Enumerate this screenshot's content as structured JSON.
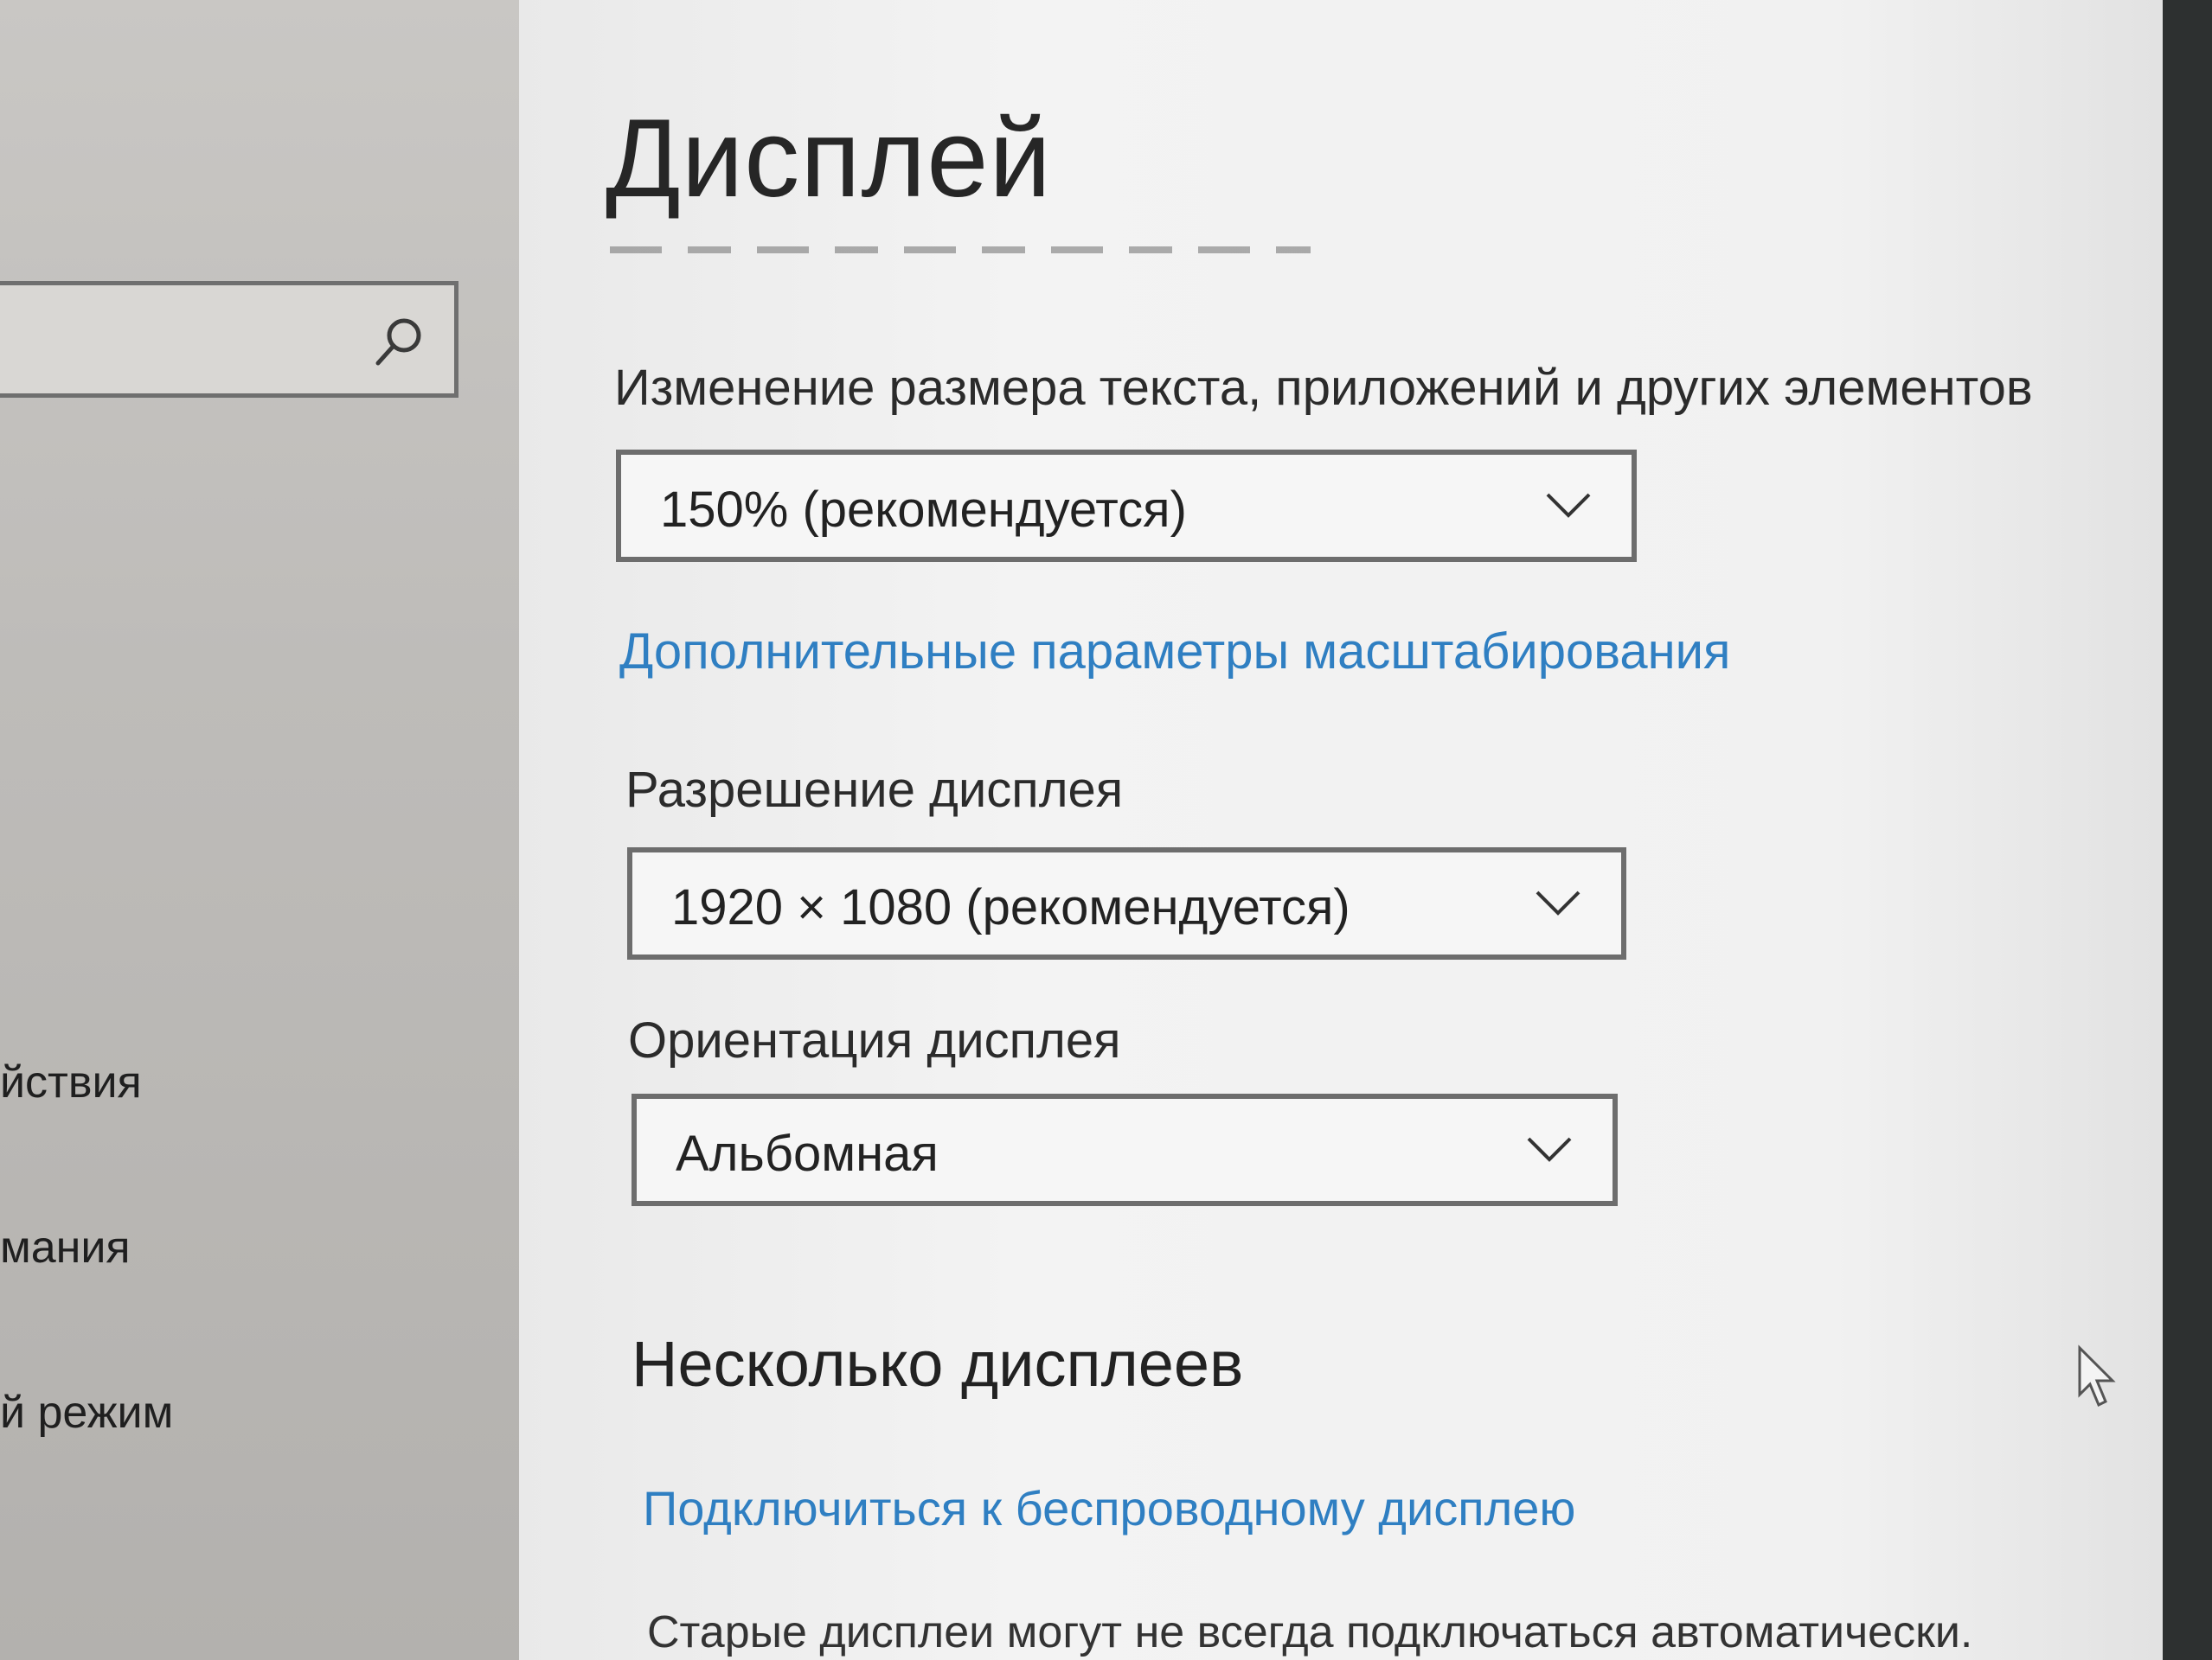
{
  "sidebar": {
    "search": {
      "value": "",
      "icon": "search-icon"
    },
    "items": [
      {
        "label": "йствия"
      },
      {
        "label": "мания"
      },
      {
        "label": "й режим"
      }
    ]
  },
  "main": {
    "title": "Дисплей",
    "scale": {
      "label": "Изменение размера текста, приложений и других элементов",
      "selected": "150% (рекомендуется)",
      "icon": "chevron-down-icon"
    },
    "scaling_link": "Дополнительные параметры масштабирования",
    "resolution": {
      "label": "Разрешение дисплея",
      "selected": "1920 × 1080 (рекомендуется)",
      "icon": "chevron-down-icon"
    },
    "orientation": {
      "label": "Ориентация дисплея",
      "selected": "Альбомная",
      "icon": "chevron-down-icon"
    },
    "multiple_displays": {
      "heading": "Несколько дисплеев",
      "wireless_link": "Подключиться к беспроводному дисплею",
      "note": "Старые дисплеи могут не всегда подключаться автоматически."
    }
  },
  "colors": {
    "link": "#2f7fc2",
    "text": "#2b2b2b",
    "border": "#6d6d6d"
  }
}
